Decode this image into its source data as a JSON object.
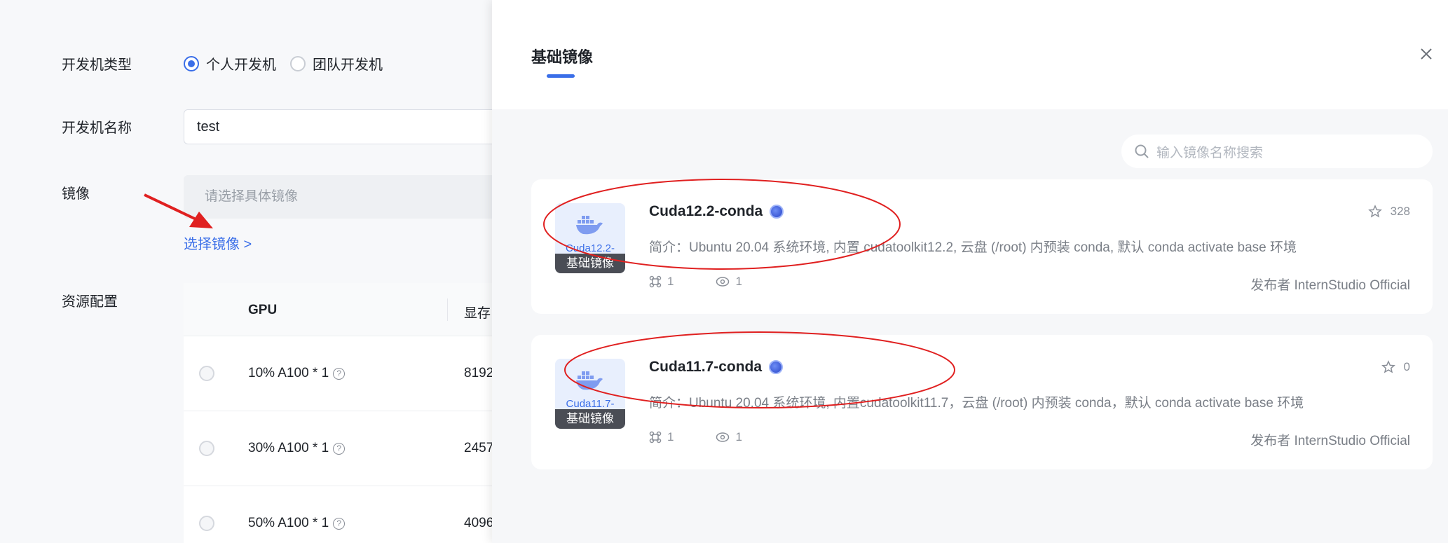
{
  "form": {
    "type_label": "开发机类型",
    "type_options": [
      "个人开发机",
      "团队开发机"
    ],
    "name_label": "开发机名称",
    "name_value": "test",
    "mirror_label": "镜像",
    "mirror_placeholder": "请选择具体镜像",
    "select_link": "选择镜像 >",
    "resource_label": "资源配置",
    "table_headers": [
      "GPU",
      "显存"
    ],
    "rows": [
      {
        "gpu": "10% A100 * 1",
        "mem": "8192"
      },
      {
        "gpu": "30% A100 * 1",
        "mem": "2457"
      },
      {
        "gpu": "50% A100 * 1",
        "mem": "4096"
      }
    ]
  },
  "drawer": {
    "tab": "基础镜像",
    "search_placeholder": "输入镜像名称搜索",
    "cards": [
      {
        "thumb_name": "Cuda12.2-",
        "thumb_badge": "基础镜像",
        "title": "Cuda12.2-conda",
        "desc": "简介：Ubuntu 20.04 系统环境, 内置 cudatoolkit12.2, 云盘 (/root) 内预装 conda, 默认 conda activate base 环境",
        "forks": "1",
        "views": "1",
        "stars": "328",
        "publisher": "发布者   InternStudio Official"
      },
      {
        "thumb_name": "Cuda11.7-",
        "thumb_badge": "基础镜像",
        "title": "Cuda11.7-conda",
        "desc": "简介：Ubuntu 20.04 系统环境, 内置cudatoolkit11.7，云盘 (/root) 内预装 conda，默认 conda activate base 环境",
        "forks": "1",
        "views": "1",
        "stars": "0",
        "publisher": "发布者   InternStudio Official"
      }
    ]
  },
  "colors": {
    "accent": "#3a6ee8",
    "annotation": "#e02020"
  }
}
